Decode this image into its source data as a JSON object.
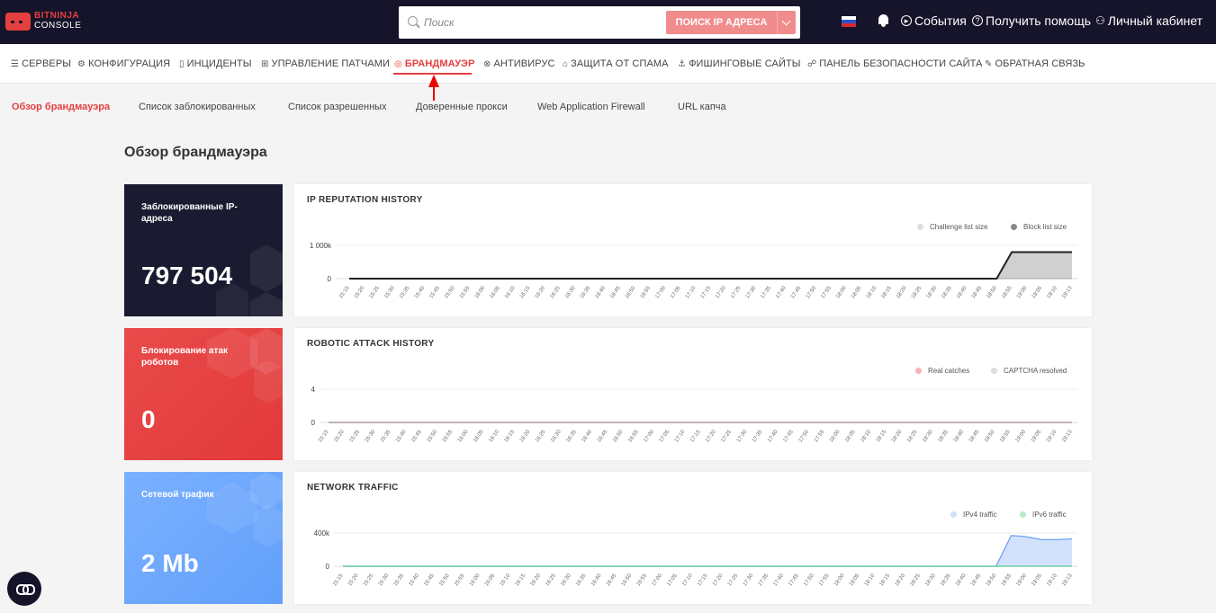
{
  "logo": {
    "line1": "BITNINJA",
    "line2": "CONSOLE"
  },
  "search": {
    "placeholder": "Поиск",
    "button_label": "ПОИСК IP АДРЕСА"
  },
  "topnav": {
    "events": "События",
    "help": "Получить помощь",
    "account": "Личный кабинет"
  },
  "mainnav": [
    {
      "label": "СЕРВЕРЫ",
      "icon": "servers-icon",
      "glyph": "☰"
    },
    {
      "label": "КОНФИГУРАЦИЯ",
      "icon": "gear-icon",
      "glyph": "⚙"
    },
    {
      "label": "ИНЦИДЕНТЫ",
      "icon": "document-icon",
      "glyph": "▯"
    },
    {
      "label": "УПРАВЛЕНИЕ ПАТЧАМИ",
      "icon": "grid-icon",
      "glyph": "⊞"
    },
    {
      "label": "БРАНДМАУЭР",
      "icon": "firewall-icon",
      "glyph": "◎",
      "active": true
    },
    {
      "label": "АНТИВИРУС",
      "icon": "virus-icon",
      "glyph": "⊗"
    },
    {
      "label": "ЗАЩИТА ОТ СПАМА",
      "icon": "lock-icon",
      "glyph": "⌂"
    },
    {
      "label": "ФИШИНГОВЫЕ САЙТЫ",
      "icon": "anchor-icon",
      "glyph": "⚓"
    },
    {
      "label": "ПАНЕЛЬ БЕЗОПАСНОСТИ САЙТА",
      "icon": "users-icon",
      "glyph": "☍"
    },
    {
      "label": "ОБРАТНАЯ СВЯЗЬ",
      "icon": "pencil-icon",
      "glyph": "✎"
    }
  ],
  "subtabs": [
    {
      "label": "Обзор брандмауэра",
      "active": true
    },
    {
      "label": "Список заблокированных"
    },
    {
      "label": "Список разрешенных"
    },
    {
      "label": "Доверенные прокси"
    },
    {
      "label": "Web Application Firewall"
    },
    {
      "label": "URL капча"
    }
  ],
  "page_title": "Обзор брандмауэра",
  "stats": [
    {
      "label": "Заблокированные IP-адреса",
      "value": "797 504",
      "color": "#1a1a30"
    },
    {
      "label": "Блокирование атак роботов",
      "value": "0",
      "color": "#e53f3f"
    },
    {
      "label": "Сетевой трафик",
      "value": "2 Mb",
      "color": "#6ea8fe"
    }
  ],
  "times": [
    "15:15",
    "15:20",
    "15:25",
    "15:30",
    "15:35",
    "15:40",
    "15:45",
    "15:50",
    "15:55",
    "16:00",
    "16:05",
    "16:10",
    "16:15",
    "16:20",
    "16:25",
    "16:30",
    "16:35",
    "16:40",
    "16:45",
    "16:50",
    "16:55",
    "17:00",
    "17:05",
    "17:10",
    "17:15",
    "17:20",
    "17:25",
    "17:30",
    "17:35",
    "17:40",
    "17:45",
    "17:50",
    "17:55",
    "18:00",
    "18:05",
    "18:10",
    "18:15",
    "18:20",
    "18:25",
    "18:30",
    "18:35",
    "18:40",
    "18:45",
    "18:50",
    "18:55",
    "19:00",
    "19:05",
    "19:10",
    "19:13"
  ],
  "charts": [
    {
      "title": "IP REPUTATION HISTORY",
      "legend": [
        {
          "name": "Challenge list size",
          "color": "#dddddd"
        },
        {
          "name": "Block list size",
          "color": "#888888"
        }
      ],
      "yticks": [
        "1 000k",
        "0"
      ]
    },
    {
      "title": "ROBOTIC ATTACK HISTORY",
      "legend": [
        {
          "name": "Real catches",
          "color": "#f7b3b3"
        },
        {
          "name": "CAPTCHA resolved",
          "color": "#dddddd"
        }
      ],
      "yticks": [
        "4",
        "0"
      ]
    },
    {
      "title": "NETWORK TRAFFIC",
      "legend": [
        {
          "name": "IPv4 traffic",
          "color": "#cfe0fb"
        },
        {
          "name": "IPv6 traffic",
          "color": "#b5ecc5"
        }
      ],
      "yticks": [
        "400k",
        "0"
      ]
    }
  ],
  "chart_data": [
    {
      "type": "area",
      "title": "IP REPUTATION HISTORY",
      "x": [
        "15:15",
        "15:20",
        "15:25",
        "15:30",
        "15:35",
        "15:40",
        "15:45",
        "15:50",
        "15:55",
        "16:00",
        "16:05",
        "16:10",
        "16:15",
        "16:20",
        "16:25",
        "16:30",
        "16:35",
        "16:40",
        "16:45",
        "16:50",
        "16:55",
        "17:00",
        "17:05",
        "17:10",
        "17:15",
        "17:20",
        "17:25",
        "17:30",
        "17:35",
        "17:40",
        "17:45",
        "17:50",
        "17:55",
        "18:00",
        "18:05",
        "18:10",
        "18:15",
        "18:20",
        "18:25",
        "18:30",
        "18:35",
        "18:40",
        "18:45",
        "18:50",
        "18:55",
        "19:00",
        "19:05",
        "19:10",
        "19:13"
      ],
      "ylim": [
        0,
        1000000
      ],
      "series": [
        {
          "name": "Challenge list size",
          "values": [
            0,
            0,
            0,
            0,
            0,
            0,
            0,
            0,
            0,
            0,
            0,
            0,
            0,
            0,
            0,
            0,
            0,
            0,
            0,
            0,
            0,
            0,
            0,
            0,
            0,
            0,
            0,
            0,
            0,
            0,
            0,
            0,
            0,
            0,
            0,
            0,
            0,
            0,
            0,
            0,
            0,
            0,
            0,
            0,
            0,
            0,
            0,
            0,
            0
          ]
        },
        {
          "name": "Block list size",
          "values": [
            0,
            0,
            0,
            0,
            0,
            0,
            0,
            0,
            0,
            0,
            0,
            0,
            0,
            0,
            0,
            0,
            0,
            0,
            0,
            0,
            0,
            0,
            0,
            0,
            0,
            0,
            0,
            0,
            0,
            0,
            0,
            0,
            0,
            0,
            0,
            0,
            0,
            0,
            0,
            0,
            0,
            0,
            0,
            0,
            797504,
            797504,
            797504,
            797504,
            797504
          ]
        }
      ]
    },
    {
      "type": "line",
      "title": "ROBOTIC ATTACK HISTORY",
      "x": [
        "15:15",
        "15:20",
        "15:25",
        "15:30",
        "15:35",
        "15:40",
        "15:45",
        "15:50",
        "15:55",
        "16:00",
        "16:05",
        "16:10",
        "16:15",
        "16:20",
        "16:25",
        "16:30",
        "16:35",
        "16:40",
        "16:45",
        "16:50",
        "16:55",
        "17:00",
        "17:05",
        "17:10",
        "17:15",
        "17:20",
        "17:25",
        "17:30",
        "17:35",
        "17:40",
        "17:45",
        "17:50",
        "17:55",
        "18:00",
        "18:05",
        "18:10",
        "18:15",
        "18:20",
        "18:25",
        "18:30",
        "18:35",
        "18:40",
        "18:45",
        "18:50",
        "18:55",
        "19:00",
        "19:05",
        "19:10",
        "19:13"
      ],
      "ylim": [
        0,
        4
      ],
      "series": [
        {
          "name": "Real catches",
          "values": [
            0,
            0,
            0,
            0,
            0,
            0,
            0,
            0,
            0,
            0,
            0,
            0,
            0,
            0,
            0,
            0,
            0,
            0,
            0,
            0,
            0,
            0,
            0,
            0,
            0,
            0,
            0,
            0,
            0,
            0,
            0,
            0,
            0,
            0,
            0,
            0,
            0,
            0,
            0,
            0,
            0,
            0,
            0,
            0,
            0,
            0,
            0,
            0,
            0
          ]
        },
        {
          "name": "CAPTCHA resolved",
          "values": [
            0,
            0,
            0,
            0,
            0,
            0,
            0,
            0,
            0,
            0,
            0,
            0,
            0,
            0,
            0,
            0,
            0,
            0,
            0,
            0,
            0,
            0,
            0,
            0,
            0,
            0,
            0,
            0,
            0,
            0,
            0,
            0,
            0,
            0,
            0,
            0,
            0,
            0,
            0,
            0,
            0,
            0,
            0,
            0,
            0,
            0,
            0,
            0,
            0
          ]
        }
      ]
    },
    {
      "type": "area",
      "title": "NETWORK TRAFFIC",
      "x": [
        "15:15",
        "15:20",
        "15:25",
        "15:30",
        "15:35",
        "15:40",
        "15:45",
        "15:50",
        "15:55",
        "16:00",
        "16:05",
        "16:10",
        "16:15",
        "16:20",
        "16:25",
        "16:30",
        "16:35",
        "16:40",
        "16:45",
        "16:50",
        "16:55",
        "17:00",
        "17:05",
        "17:10",
        "17:15",
        "17:20",
        "17:25",
        "17:30",
        "17:35",
        "17:40",
        "17:45",
        "17:50",
        "17:55",
        "18:00",
        "18:05",
        "18:10",
        "18:15",
        "18:20",
        "18:25",
        "18:30",
        "18:35",
        "18:40",
        "18:45",
        "18:50",
        "18:55",
        "19:00",
        "19:05",
        "19:10",
        "19:13"
      ],
      "ylim": [
        0,
        400000
      ],
      "series": [
        {
          "name": "IPv4 traffic",
          "values": [
            0,
            0,
            0,
            0,
            0,
            0,
            0,
            0,
            0,
            0,
            0,
            0,
            0,
            0,
            0,
            0,
            0,
            0,
            0,
            0,
            0,
            0,
            0,
            0,
            0,
            0,
            0,
            0,
            0,
            0,
            0,
            0,
            0,
            0,
            0,
            0,
            0,
            0,
            0,
            0,
            0,
            0,
            0,
            0,
            370000,
            355000,
            320000,
            320000,
            330000
          ]
        },
        {
          "name": "IPv6 traffic",
          "values": [
            0,
            0,
            0,
            0,
            0,
            0,
            0,
            0,
            0,
            0,
            0,
            0,
            0,
            0,
            0,
            0,
            0,
            0,
            0,
            0,
            0,
            0,
            0,
            0,
            0,
            0,
            0,
            0,
            0,
            0,
            0,
            0,
            0,
            0,
            0,
            0,
            0,
            0,
            0,
            0,
            0,
            0,
            0,
            0,
            0,
            0,
            0,
            0,
            0
          ]
        }
      ]
    }
  ]
}
